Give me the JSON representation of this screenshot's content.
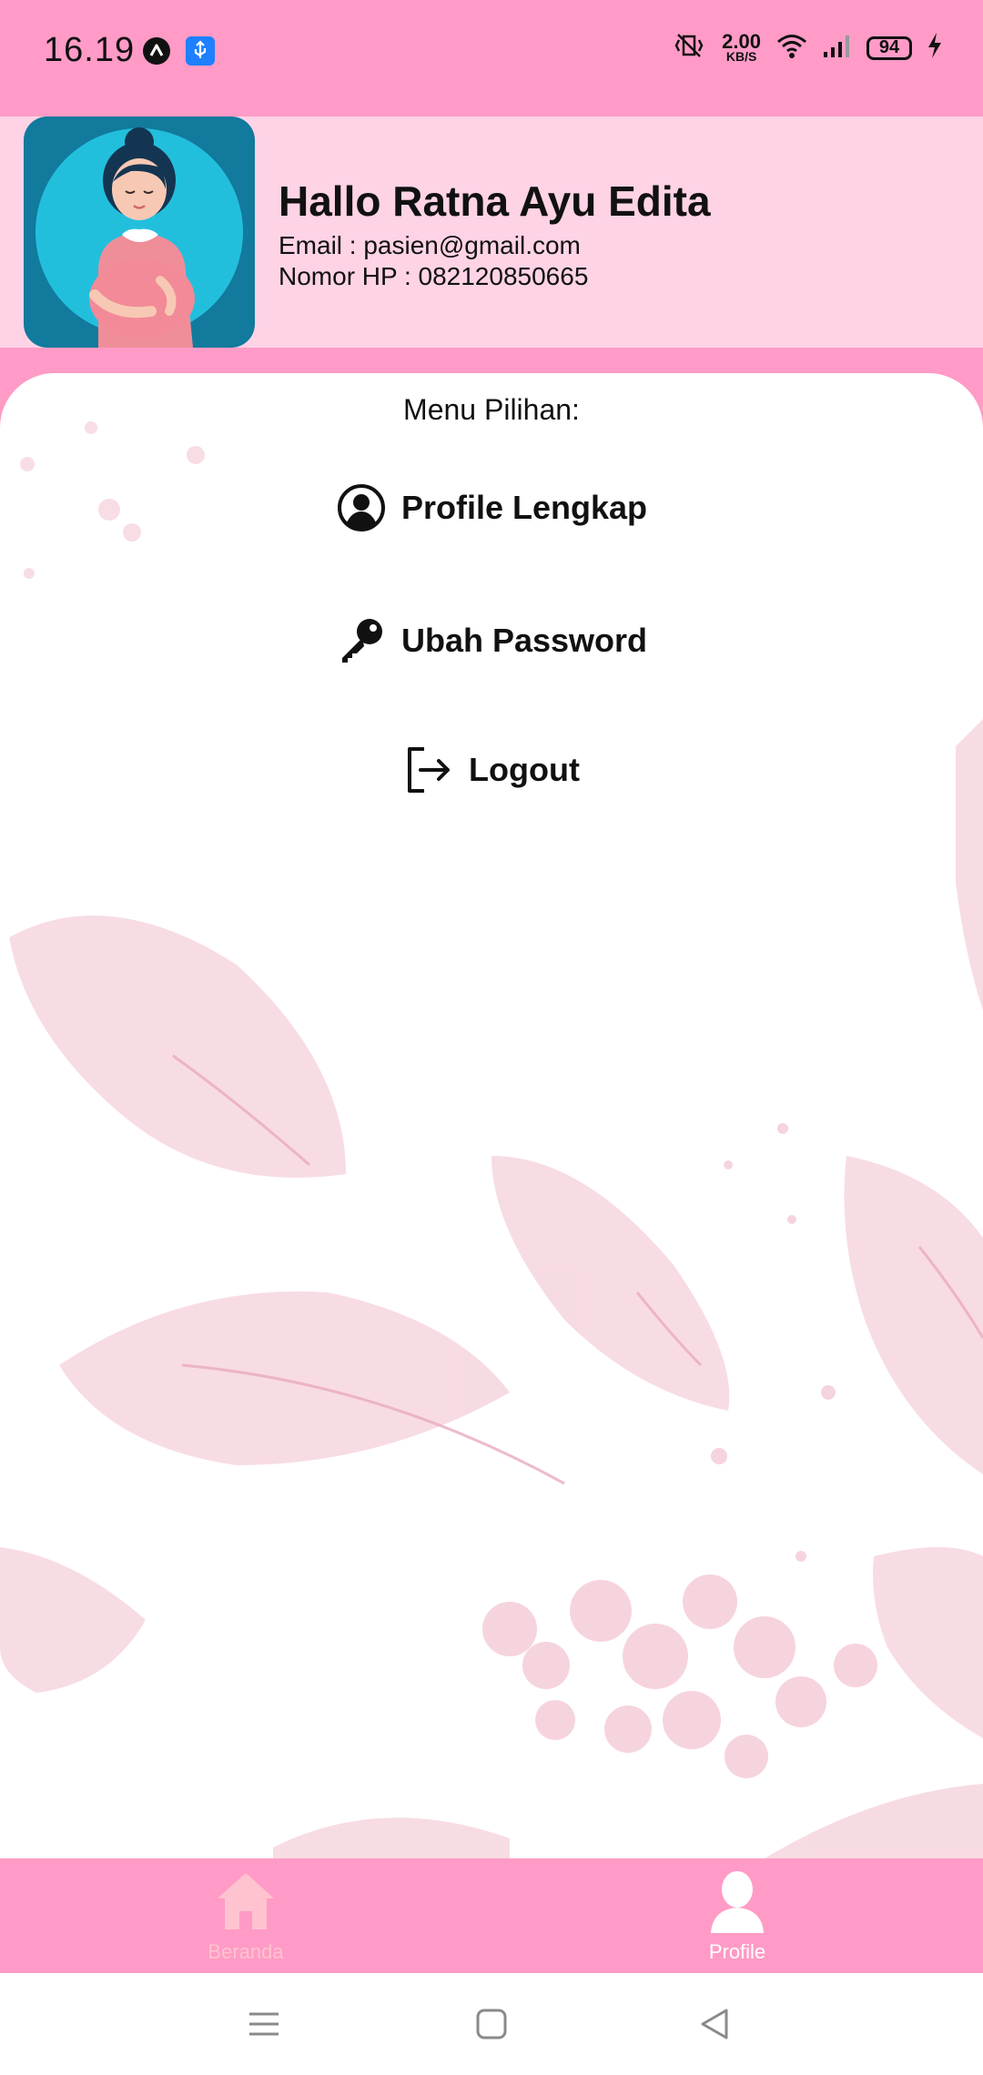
{
  "status_bar": {
    "time": "16.19",
    "net_speed_value": "2.00",
    "net_speed_unit": "KB/S",
    "battery": "94"
  },
  "header": {
    "greeting": "Hallo Ratna Ayu Edita",
    "email": "Email : pasien@gmail.com",
    "phone": "Nomor HP : 082120850665"
  },
  "menu": {
    "title": "Menu Pilihan:",
    "items": [
      {
        "label": "Profile Lengkap",
        "icon": "user-circle-icon"
      },
      {
        "label": "Ubah Password",
        "icon": "key-icon"
      },
      {
        "label": "Logout",
        "icon": "logout-icon"
      }
    ]
  },
  "bottom_nav": {
    "tabs": [
      {
        "label": "Beranda",
        "icon": "home-icon",
        "active": false
      },
      {
        "label": "Profile",
        "icon": "person-icon",
        "active": true
      }
    ]
  },
  "colors": {
    "accent_pink": "#ff9bc6",
    "header_bg": "#fed3e6",
    "avatar_bg": "#117a9d",
    "inactive_tab": "#ffc3cf"
  }
}
